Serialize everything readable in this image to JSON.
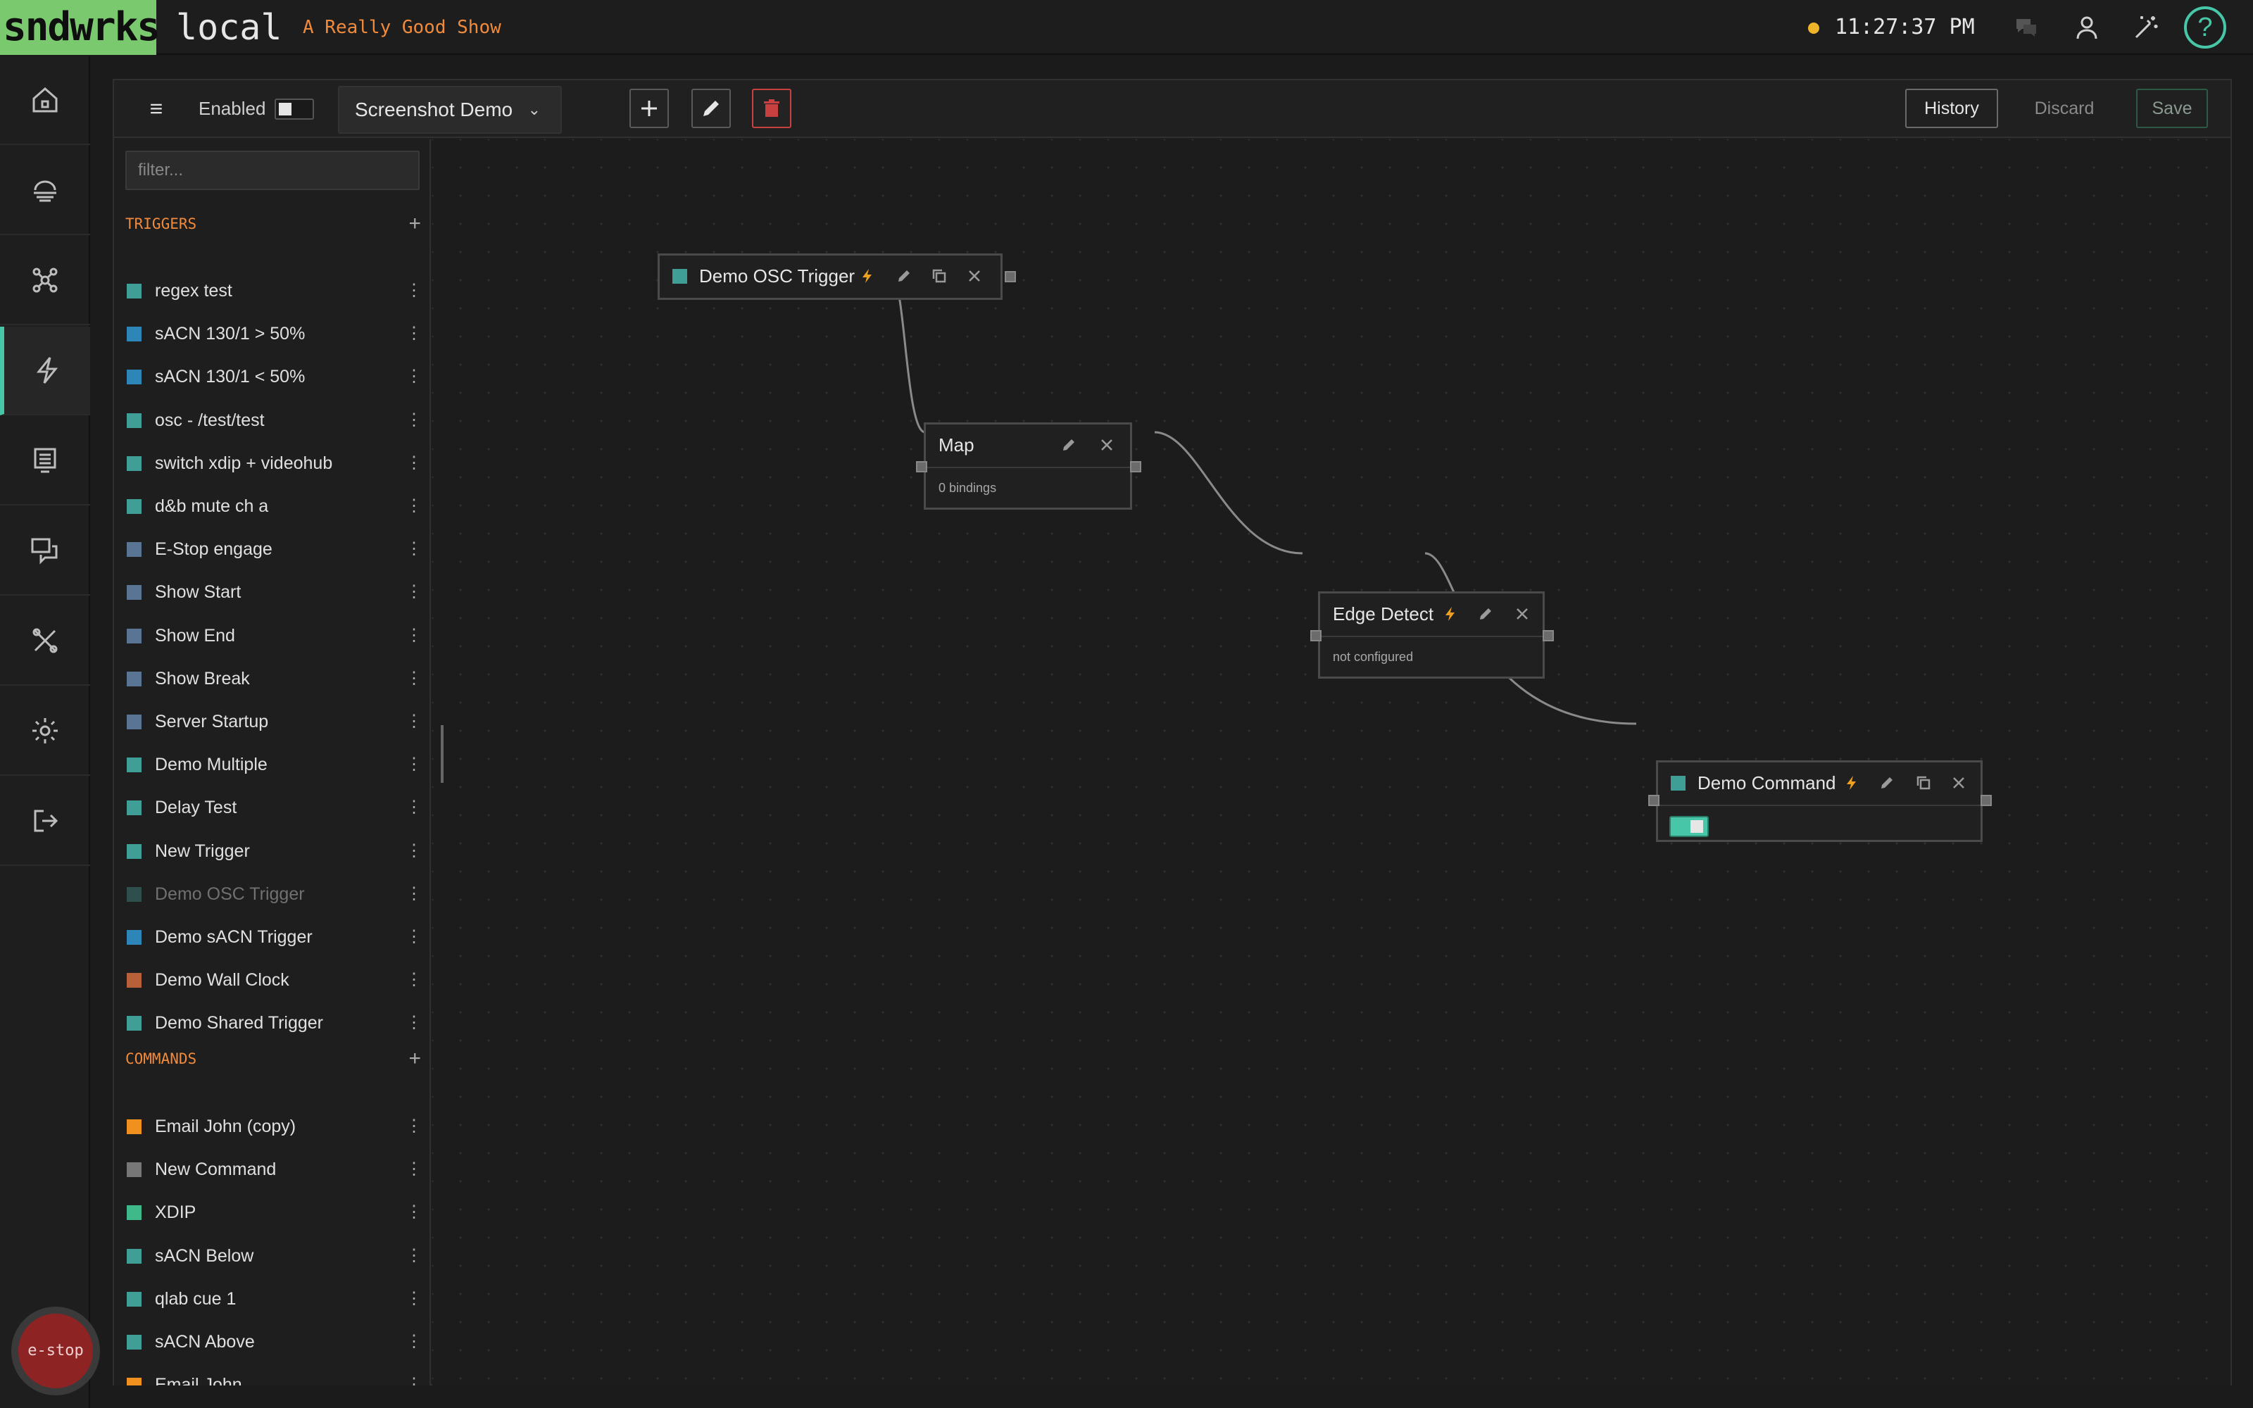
{
  "topbar": {
    "logo": "sndwrks",
    "instance": "local",
    "show_name": "A Really Good Show",
    "clock": "11:27:37 PM",
    "status_color": "#f0b429",
    "help_label": "?",
    "icons": [
      "chat-icon",
      "user-icon",
      "magic-wand-icon",
      "help-icon"
    ]
  },
  "nav": {
    "items": [
      "home",
      "network",
      "hub",
      "automation",
      "display",
      "chat",
      "tools",
      "settings",
      "logout"
    ],
    "active": "automation"
  },
  "estop_label": "e-stop",
  "toolbar": {
    "enabled_label": "Enabled",
    "enabled": false,
    "flow_name": "Screenshot Demo",
    "history_label": "History",
    "discard_label": "Discard",
    "save_label": "Save"
  },
  "sidebar": {
    "filter_placeholder": "filter...",
    "triggers_header": "TRIGGERS",
    "commands_header": "COMMANDS",
    "triggers": [
      {
        "label": "regex test",
        "color": "#3f9e96"
      },
      {
        "label": "sACN 130/1 > 50%",
        "color": "#2e86b8"
      },
      {
        "label": "sACN 130/1 < 50%",
        "color": "#2e86b8"
      },
      {
        "label": "osc - /test/test",
        "color": "#3f9e96"
      },
      {
        "label": "switch xdip + videohub",
        "color": "#3f9e96"
      },
      {
        "label": "d&b mute ch a",
        "color": "#3f9e96"
      },
      {
        "label": "E-Stop engage",
        "color": "#5a7494"
      },
      {
        "label": "Show Start",
        "color": "#5a7494"
      },
      {
        "label": "Show End",
        "color": "#5a7494"
      },
      {
        "label": "Show Break",
        "color": "#5a7494"
      },
      {
        "label": "Server Startup",
        "color": "#5a7494"
      },
      {
        "label": "Demo Multiple",
        "color": "#3f9e96"
      },
      {
        "label": "Delay Test",
        "color": "#3f9e96"
      },
      {
        "label": "New Trigger",
        "color": "#3f9e96"
      },
      {
        "label": "Demo OSC Trigger",
        "color": "#2f4f4c",
        "dim": true
      },
      {
        "label": "Demo sACN Trigger",
        "color": "#2e86b8"
      },
      {
        "label": "Demo Wall Clock",
        "color": "#b8603a"
      },
      {
        "label": "Demo Shared Trigger",
        "color": "#3f9e96"
      }
    ],
    "commands": [
      {
        "label": "Email John (copy)",
        "color": "#f0901e"
      },
      {
        "label": "New Command",
        "color": "#777777"
      },
      {
        "label": "XDIP",
        "color": "#3fb88a"
      },
      {
        "label": "sACN Below",
        "color": "#3f9e96"
      },
      {
        "label": "qlab cue 1",
        "color": "#3f9e96"
      },
      {
        "label": "sACN Above",
        "color": "#3f9e96"
      },
      {
        "label": "Email John",
        "color": "#f0901e"
      }
    ]
  },
  "nodes": {
    "osc_trigger": {
      "title": "Demo OSC Trigger",
      "color": "#3f9e96"
    },
    "map": {
      "title": "Map",
      "body": "0 bindings"
    },
    "edge_detect": {
      "title": "Edge Detect",
      "body": "not configured"
    },
    "command": {
      "title": "Demo Command",
      "color": "#3f9e96",
      "enabled": true
    }
  },
  "colors": {
    "accent": "#47c6a8",
    "section_header": "#f08a3c",
    "bolt": "#f0a020",
    "delete": "#c94040"
  }
}
